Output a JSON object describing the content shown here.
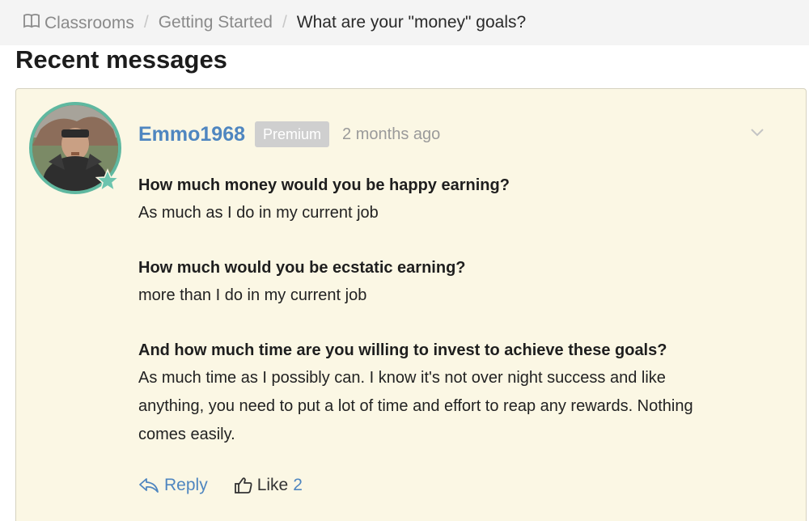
{
  "breadcrumb": {
    "items": [
      {
        "label": "Classrooms",
        "icon": "book-icon"
      },
      {
        "label": "Getting Started"
      },
      {
        "label": "What are your \"money\" goals?"
      }
    ],
    "separator": "/"
  },
  "section": {
    "title": "Recent messages"
  },
  "message": {
    "author": "Emmo1968",
    "badge": "Premium",
    "timestamp": "2 months ago",
    "avatar_icon": "user-avatar",
    "status_icon": "star-icon",
    "menu_icon": "chevron-down-icon",
    "qa": [
      {
        "question": "How much money would you be happy earning?",
        "answer": "As much as I do in my current job"
      },
      {
        "question": "How much would you be ecstatic earning?",
        "answer": "more than I do in my current job"
      },
      {
        "question": "And how much time are you willing to invest to achieve these goals?",
        "answer_lines": [
          "As much time as I possibly can. I know it's not over night success and like",
          "anything, you need to put a lot of time and effort to reap any rewards. Nothing",
          "comes easily."
        ]
      }
    ],
    "actions": {
      "reply_label": "Reply",
      "like_label": "Like",
      "like_count": "2"
    }
  },
  "colors": {
    "link": "#4f86c0",
    "card_background": "#fbf7e4",
    "avatar_ring": "#5fb8a0",
    "badge_background": "#cfcfcf"
  }
}
